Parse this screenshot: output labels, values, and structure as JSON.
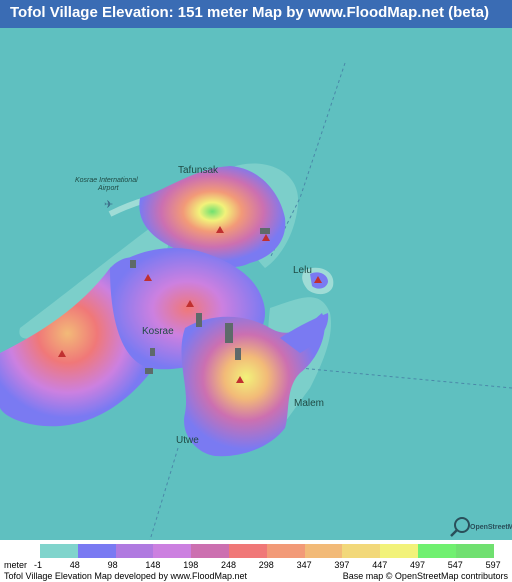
{
  "title": "Tofol Village Elevation: 151 meter Map by www.FloodMap.net (beta)",
  "map": {
    "labels": {
      "tafunsak": "Tafunsak",
      "airport": "Kosrae International Airport",
      "airport_line1": "Kosrae International",
      "airport_line2": "Airport",
      "lelu": "Lelu",
      "kosrae": "Kosrae",
      "malem": "Malem",
      "utwe": "Utwe"
    },
    "osm_logo_text": "OpenStreetMap",
    "colors": {
      "sea": "#5fc0c0",
      "shallow": "#7ccfca",
      "reef": "#9fdcd6"
    }
  },
  "legend": {
    "unit": "meter",
    "values": [
      "-1",
      "48",
      "98",
      "148",
      "198",
      "248",
      "298",
      "347",
      "397",
      "447",
      "497",
      "547",
      "597"
    ],
    "colors": [
      "#80d4cc",
      "#7a7af2",
      "#b07ae0",
      "#cc80e0",
      "#cc70b0",
      "#f07878",
      "#f29a78",
      "#f2ba78",
      "#f2d87a",
      "#f2f27a",
      "#70f070",
      "#70e070"
    ]
  },
  "footer": {
    "left": "Tofol Village Elevation Map developed by www.FloodMap.net",
    "right": "Base map © OpenStreetMap contributors"
  }
}
